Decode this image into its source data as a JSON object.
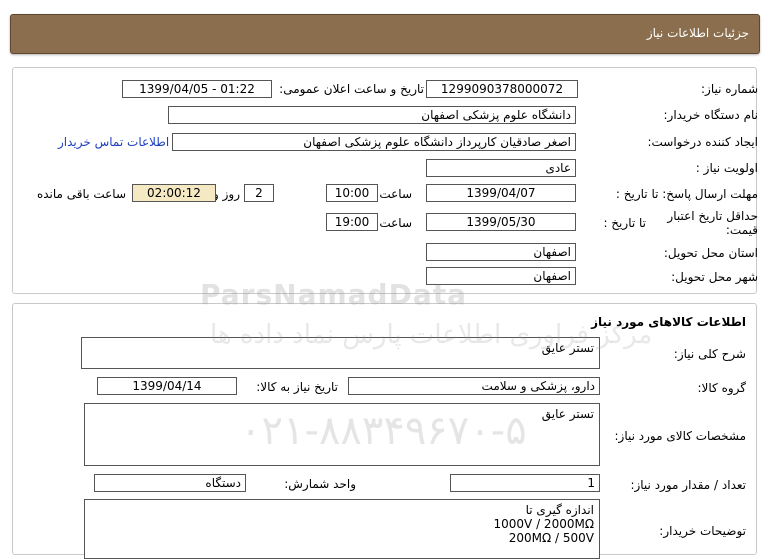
{
  "header": {
    "title": "جزئیات اطلاعات نیاز"
  },
  "info": {
    "need_number_label": "شماره نیاز:",
    "need_number": "1299090378000072",
    "announce_label": "تاریخ و ساعت اعلان عمومی:",
    "announce_value": "1399/04/05 - 01:22",
    "buyer_org_label": "نام دستگاه خریدار:",
    "buyer_org": "دانشگاه علوم پزشکی اصفهان",
    "requester_label": "ایجاد کننده درخواست:",
    "requester": "اصغر صادقیان کارپرداز دانشگاه علوم پزشکی اصفهان",
    "contact_link": "اطلاعات تماس خریدار",
    "priority_label": "اولویت نیاز :",
    "priority": "عادی",
    "deadline_label": "مهلت ارسال پاسخ: تا تاریخ :",
    "deadline_date": "1399/04/07",
    "time_label": "ساعت",
    "deadline_time": "10:00",
    "days": "2",
    "days_label": "روز و",
    "remaining_time": "02:00:12",
    "remaining_label": "ساعت باقی مانده",
    "validity_label": "حداقل تاریخ اعتبار قیمت:",
    "validity_to_label": "تا تاریخ :",
    "validity_date": "1399/05/30",
    "validity_time_label": "ساعت",
    "validity_time": "19:00",
    "province_label": "استان محل تحویل:",
    "province": "اصفهان",
    "city_label": "شهر محل تحویل:",
    "city": "اصفهان"
  },
  "goods": {
    "section_title": "اطلاعات کالاهای مورد نیاز",
    "summary_label": "شرح کلی نیاز:",
    "summary": "تستر عایق",
    "group_label": "گروه کالا:",
    "group": "دارو، پزشکی و سلامت",
    "need_date_label": "تاریخ نیاز به کالا:",
    "need_date": "1399/04/14",
    "spec_label": "مشخصات کالای مورد نیاز:",
    "spec": "تستر عایق",
    "qty_label": "تعداد / مقدار مورد نیاز:",
    "qty": "1",
    "unit_label": "واحد شمارش:",
    "unit": "دستگاه",
    "buyer_notes_label": "توضیحات خریدار:",
    "buyer_notes_1": "اندازه گیری تا",
    "buyer_notes_2": "1000V  /  2000MΩ",
    "buyer_notes_3": "200MΩ  /  500V"
  },
  "watermark": {
    "line1": "ParsNamadData",
    "line2": "مرکز فراوری اطلاعات پارس نماد داده ها",
    "line3": "۰۲۱-۸۸۳۴۹۶۷۰-۵"
  }
}
